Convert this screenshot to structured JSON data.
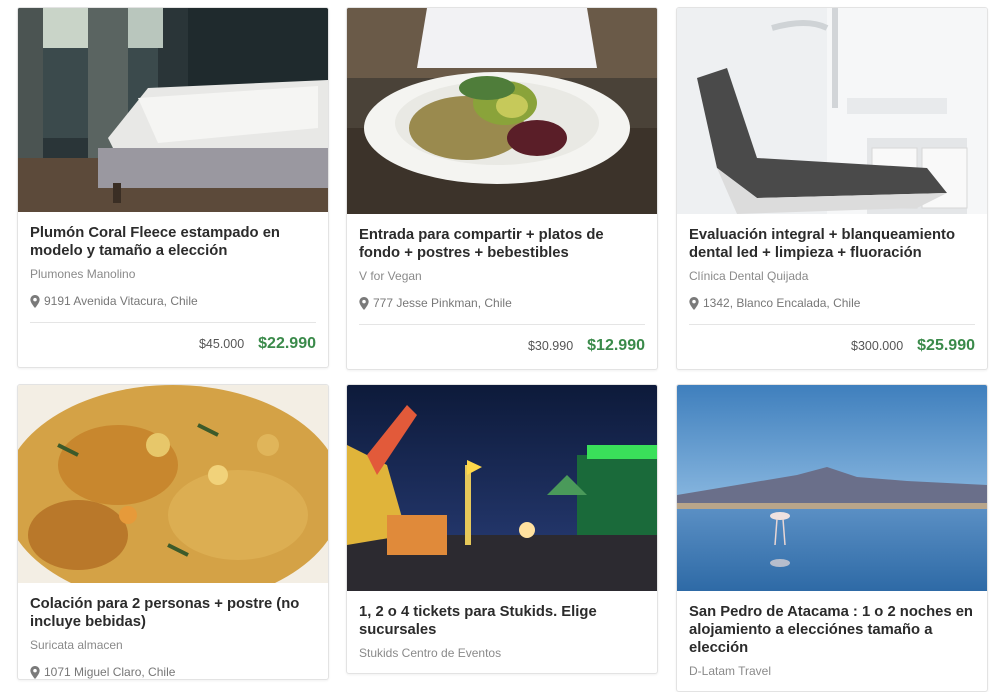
{
  "colors": {
    "price": "#3a8a4a",
    "border": "#e3e3e3"
  },
  "deals": [
    {
      "title": "Plumón Coral Fleece estampado en modelo y tamaño a elección",
      "merchant": "Plumones Manolino",
      "location": "9191 Avenida Vitacura, Chile",
      "old_price": "$45.000",
      "new_price": "$22.990",
      "image": "bedroom-photo"
    },
    {
      "title": "Entrada para compartir + platos de fondo + postres + bebestibles",
      "merchant": "V for Vegan",
      "location": "777 Jesse Pinkman, Chile",
      "old_price": "$30.990",
      "new_price": "$12.990",
      "image": "vegan-dish-photo"
    },
    {
      "title": "Evaluación integral + blanqueamiento dental led + limpieza + fluoración",
      "merchant": "Clínica Dental Quijada",
      "location": "1342, Blanco Encalada, Chile",
      "old_price": "$300.000",
      "new_price": "$25.990",
      "image": "dental-chair-photo"
    },
    {
      "title": "Colación para 2 personas + postre (no incluye bebidas)",
      "merchant": "Suricata almacen",
      "location": "1071 Miguel Claro, Chile",
      "image": "lentil-dish-photo"
    },
    {
      "title": "1, 2 o 4 tickets para Stukids. Elige sucursales",
      "merchant": "Stukids Centro de Eventos",
      "image": "amusement-park-photo"
    },
    {
      "title": "San Pedro de Atacama : 1 o 2 noches en alojamiento a elecciónes tamaño a elección",
      "merchant": "D-Latam Travel",
      "image": "flamingo-lagoon-photo"
    }
  ]
}
